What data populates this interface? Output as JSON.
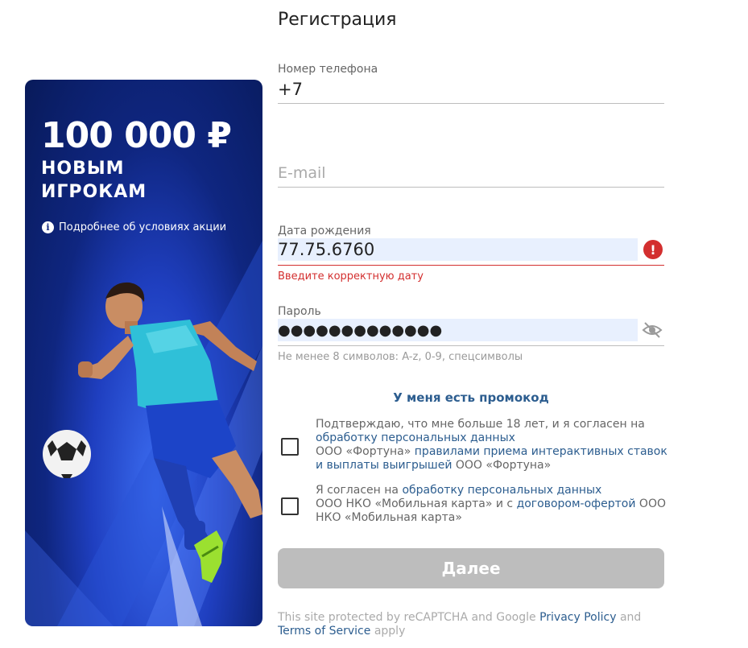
{
  "page": {
    "title": "Регистрация"
  },
  "promo": {
    "amount": "100 000 ₽",
    "line1": "НОВЫМ",
    "line2": "ИГРОКАМ",
    "info_link": "Подробнее об условиях акции"
  },
  "form": {
    "phone": {
      "label": "Номер телефона",
      "value": "+7"
    },
    "email": {
      "placeholder": "E-mail"
    },
    "birthdate": {
      "label": "Дата рождения",
      "value": "77.75.6760",
      "error": "Введите корректную дату"
    },
    "password": {
      "label": "Пароль",
      "value": "●●●●●●●●●●●●●",
      "hint": "Не менее 8 символов: A-z, 0-9, спецсимволы"
    },
    "promo_code_link": "У меня есть промокод"
  },
  "consents": [
    {
      "pre": "Подтверждаю, что мне больше 18 лет, и я согласен на",
      "link1": "обработку персональных данных",
      "mid": "ООО «Фортуна»",
      "link2": "правилами приема интерактивных ставок и выплаты выигрышей",
      "post": "ООО «Фортуна»"
    },
    {
      "pre": "Я согласен на",
      "link1": "обработку персональных данных",
      "mid": "ООО НКО «Мобильная карта» и с",
      "link2": "договором-офертой",
      "post": "ООО НКО «Мобильная карта»"
    }
  ],
  "submit_label": "Далее",
  "recaptcha": {
    "pre": "This site protected by reCAPTCHA and Google",
    "privacy": "Privacy Policy",
    "and": "and",
    "terms": "Terms of Service",
    "post": "apply"
  },
  "colors": {
    "link": "#2c5d8f",
    "error": "#d32f2f",
    "autofill": "#e8f0fe",
    "button_disabled": "#bdbdbd",
    "promo_bg": "#0f2680"
  }
}
